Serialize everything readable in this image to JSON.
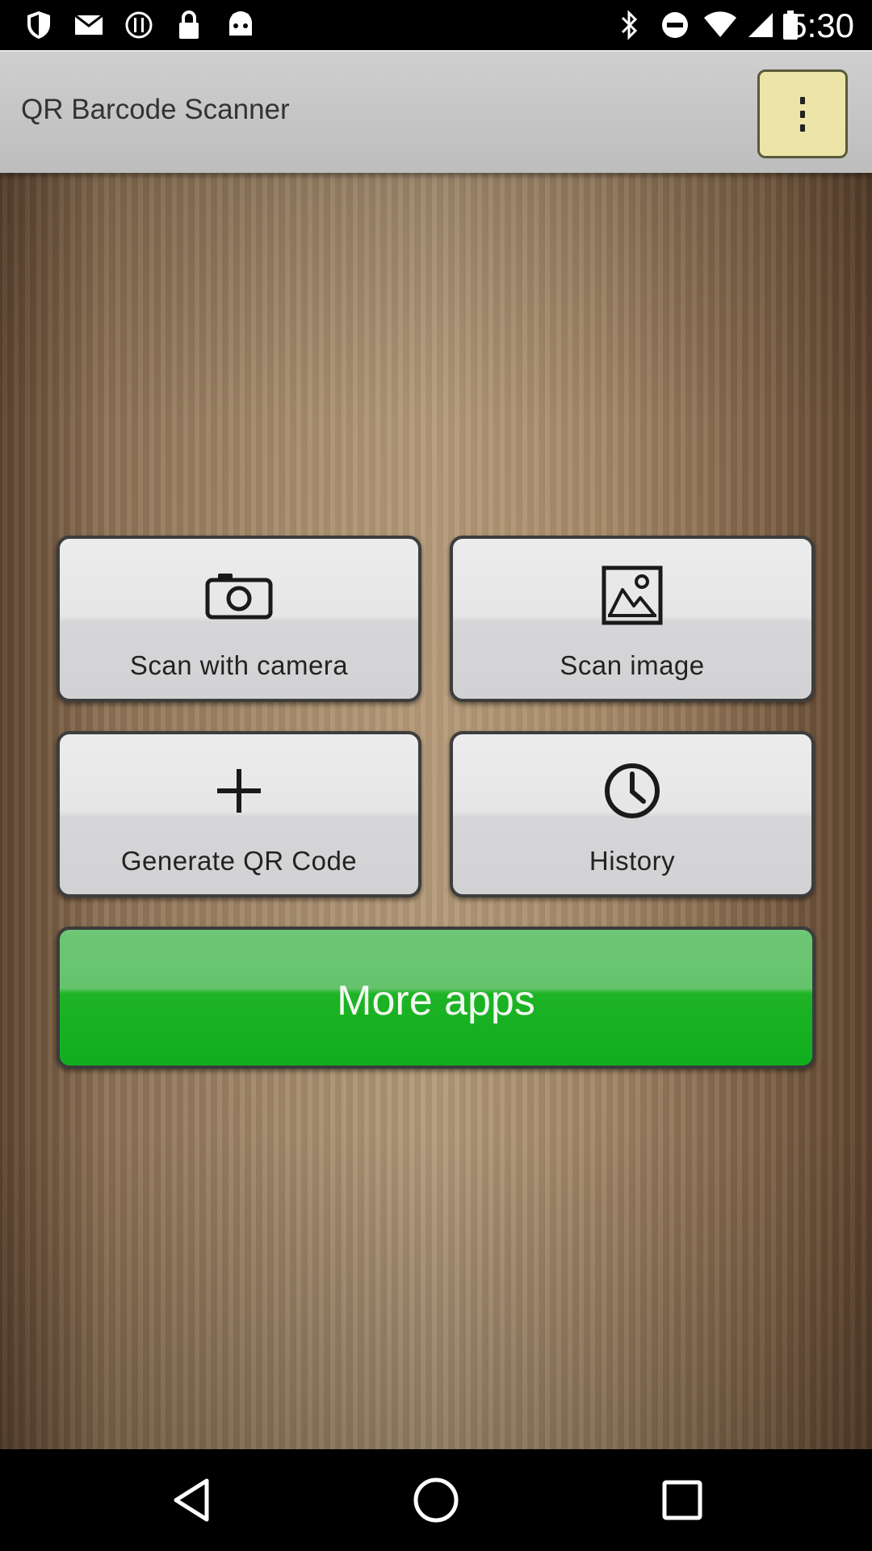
{
  "status_bar": {
    "time": "5:30",
    "left_icons": [
      "shield-icon",
      "mail-icon",
      "info-icon",
      "lock-icon",
      "android-icon"
    ],
    "right_icons": [
      "bluetooth-icon",
      "do-not-disturb-icon",
      "wifi-icon",
      "signal-icon",
      "battery-icon"
    ]
  },
  "action_bar": {
    "title": "QR Barcode Scanner",
    "overflow_icon": "more-vert-icon"
  },
  "tiles": [
    {
      "label": "Scan with camera",
      "icon": "camera-icon"
    },
    {
      "label": "Scan image",
      "icon": "image-icon"
    },
    {
      "label": "Generate QR Code",
      "icon": "plus-icon"
    },
    {
      "label": "History",
      "icon": "clock-icon"
    }
  ],
  "more_apps": {
    "label": "More apps"
  },
  "nav_bar": {
    "icons": [
      "back-icon",
      "home-icon",
      "recents-icon"
    ]
  },
  "colors": {
    "action_bar": "#c6c6c6",
    "overflow_button": "#ede4a8",
    "tile": "#e4e4e5",
    "more_apps": "#10ae1e",
    "background": "#a58c6f"
  }
}
